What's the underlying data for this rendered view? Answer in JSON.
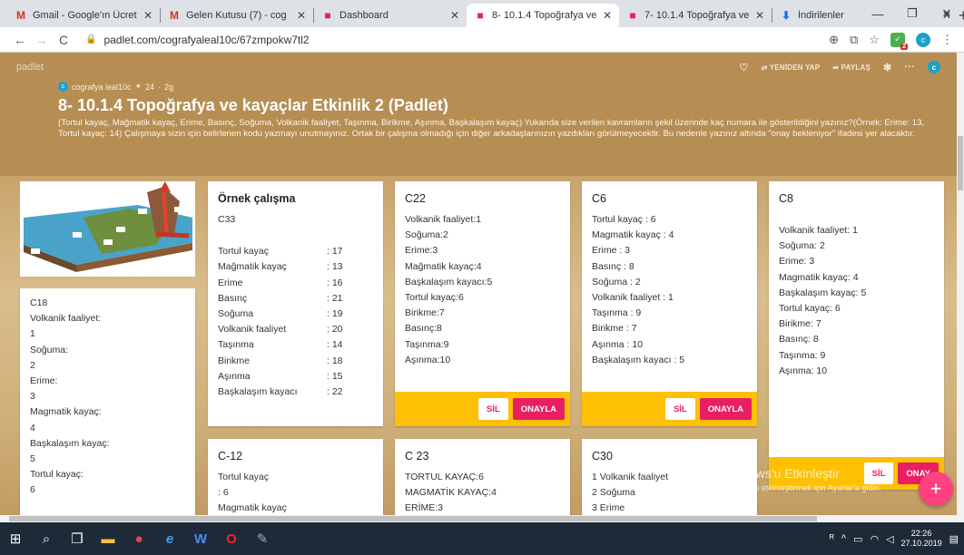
{
  "browser": {
    "tabs": [
      {
        "icon": "gmail-icon",
        "glyph": "M",
        "color": "#d93025",
        "title": "Gmail - Google'ın Ücret"
      },
      {
        "icon": "gmail-icon",
        "glyph": "M",
        "color": "#d93025",
        "title": "Gelen Kutusu (7) - cog"
      },
      {
        "icon": "padlet-icon",
        "glyph": "■",
        "color": "#e91e63",
        "title": "Dashboard"
      },
      {
        "icon": "padlet-icon",
        "glyph": "■",
        "color": "#e91e63",
        "title": "8- 10.1.4 Topoğrafya ve"
      },
      {
        "icon": "padlet-icon",
        "glyph": "■",
        "color": "#e91e63",
        "title": "7- 10.1.4 Topoğrafya ve"
      },
      {
        "icon": "download-icon",
        "glyph": "⬇",
        "color": "#1a73e8",
        "title": "İndirilenler"
      }
    ],
    "url": "padlet.com/cografyaleal10c/67zmpokw7tl2",
    "ext_badge": "2",
    "profile": "c"
  },
  "padlet": {
    "logo": "padlet",
    "actions": {
      "remake": "YENİDEN YAP",
      "share": "PAYLAŞ"
    },
    "avatar": "c",
    "author": "cografya leal10c",
    "likes": "24",
    "age": "2g",
    "title": "8- 10.1.4 Topoğrafya ve kayaçlar Etkinlik 2 (Padlet)",
    "description": "(Tortul kayaç, Mağmatik kayaç, Erime, Basınç, Soğuma, Volkanik faaliyet, Taşınma, Birikme, Aşınma, Başkalaşım kayaç) Yukarıda size verilen kavramların şekil üzerinde kaç numara ile gösterildiğini yazınız?(Örnek: Erime: 13, Tortul kayaç: 14) Çalışmaya sizin için belirlenen kodu yazmayı unutmayınız. Ortak bir çalışma olmadığı için diğer arkadaşlarınızın yazdıkları görülmeyecektir. Bu nedenle yazınız altında \"onay bekleniyor\" ifadesi yer alacaktır."
  },
  "cards": {
    "c18": {
      "lines": [
        "C18",
        "Volkanik faaliyet:",
        "1",
        "Soğuma:",
        "2",
        "Erime:",
        "3",
        "Magmatik kayaç:",
        "4",
        "Başkalaşım kayaç:",
        "5",
        "Tortul kayaç:",
        "6"
      ]
    },
    "ornek": {
      "title": "Örnek çalışma",
      "code": "C33",
      "rows": [
        {
          "k": "Tortul kayaç",
          "v": ": 17"
        },
        {
          "k": "Mağmatik kayaç",
          "v": ": 13"
        },
        {
          "k": "Erime",
          "v": ": 16"
        },
        {
          "k": "Basınç",
          "v": ": 21"
        },
        {
          "k": "Soğuma",
          "v": ": 19"
        },
        {
          "k": "Volkanik faaliyet",
          "v": ": 20"
        },
        {
          "k": "Taşınma",
          "v": ": 14"
        },
        {
          "k": "Birikme",
          "v": ": 18"
        },
        {
          "k": "Aşınma",
          "v": ": 15"
        },
        {
          "k": "Başkalaşım kayacı",
          "v": ": 22"
        }
      ]
    },
    "c22": {
      "title": "C22",
      "lines": [
        "Volkanik faaliyet:1",
        "Soğuma:2",
        "Erime:3",
        "Mağmatik kayaç:4",
        "Başkalaşım kayacı:5",
        "Tortul kayaç:6",
        "Birikme:7",
        "Basınç:8",
        "Taşınma:9",
        "Aşınma:10"
      ]
    },
    "c6": {
      "title": "C6",
      "lines": [
        "Tortul kayaç : 6",
        "Magmatik kayaç : 4",
        "Erime : 3",
        "Basınç : 8",
        "Soğuma : 2",
        "Volkanik faaliyet : 1",
        "Taşınma : 9",
        "Birikme : 7",
        "Aşınma : 10",
        "Başkalaşım kayacı : 5"
      ]
    },
    "c8": {
      "title": "C8",
      "lines": [
        "Volkanik faaliyet: 1",
        "Soğuma: 2",
        "Erime: 3",
        "Magmatik kayaç: 4",
        "Başkalaşım kayaç: 5",
        "Tortul kayaç: 6",
        "Birikme: 7",
        "Basınç: 8",
        "Taşınma: 9",
        "Aşınma: 10"
      ]
    },
    "c12": {
      "title": "C-12",
      "lines": [
        "Tortul kayaç",
        ": 6",
        "Magmatik kayaç"
      ]
    },
    "c23": {
      "title": "C 23",
      "lines": [
        "TORTUL KAYAÇ:6",
        "MAGMATİK KAYAÇ:4",
        "ERİME:3"
      ]
    },
    "c30": {
      "title": "C30",
      "lines": [
        "1 Volkanik faaliyet",
        "2 Soğuma",
        "3 Erime"
      ]
    }
  },
  "buttons": {
    "delete": "SİL",
    "approve": "ONAYLA",
    "approve_cut": "ONAY"
  },
  "watermark": {
    "line1": "Windows'u Etkinleştir",
    "line2": "Windows'u etkinleştirmek için Ayarlar'a gidin."
  },
  "taskbar": {
    "time": "22:26",
    "date": "27.10.2019"
  }
}
